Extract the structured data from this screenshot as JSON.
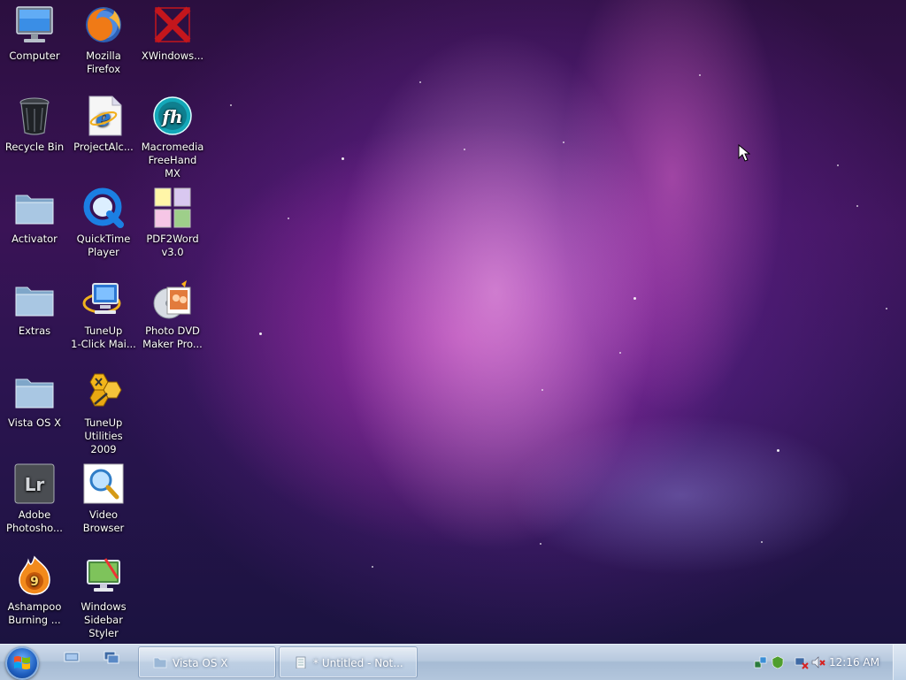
{
  "desktop": {
    "icons": [
      {
        "name": "computer",
        "label": "Computer"
      },
      {
        "name": "mozilla-firefox",
        "label": "Mozilla\nFirefox"
      },
      {
        "name": "xwindows",
        "label": "XWindows..."
      },
      {
        "name": "recycle-bin",
        "label": "Recycle Bin"
      },
      {
        "name": "projectalc",
        "label": "ProjectAlc..."
      },
      {
        "name": "macromedia-freehand",
        "label": "Macromedia\nFreeHand MX"
      },
      {
        "name": "activator",
        "label": "Activator"
      },
      {
        "name": "quicktime-player",
        "label": "QuickTime\nPlayer"
      },
      {
        "name": "pdf2word",
        "label": "PDF2Word\nv3.0"
      },
      {
        "name": "extras",
        "label": "Extras"
      },
      {
        "name": "tuneup-1click",
        "label": "TuneUp\n1-Click Mai..."
      },
      {
        "name": "photo-dvd-maker",
        "label": "Photo DVD\nMaker Pro..."
      },
      {
        "name": "vista-os-x",
        "label": "Vista OS X"
      },
      {
        "name": "tuneup-utilities",
        "label": "TuneUp\nUtilities 2009"
      },
      {
        "name": "adobe-photoshop",
        "label": "Adobe\nPhotosho..."
      },
      {
        "name": "video-browser",
        "label": "Video\nBrowser"
      },
      {
        "name": "ashampoo-burning",
        "label": "Ashampoo\nBurning ..."
      },
      {
        "name": "windows-sidebar-styler",
        "label": "Windows\nSidebar Styler"
      }
    ]
  },
  "taskbar": {
    "start_icon": "windows-logo-icon",
    "quick_launch": [
      "show-desktop-icon",
      "switch-windows-icon"
    ],
    "buttons": [
      {
        "label": "Vista OS X",
        "icon": "folder-icon"
      },
      {
        "label": "* Untitled - Not...",
        "icon": "notepad-icon"
      }
    ],
    "tray_icons": [
      "network-icon",
      "security-icon",
      "network-disconnected-icon",
      "volume-muted-icon"
    ],
    "clock": "12:16 AM"
  },
  "colors": {
    "taskbar": "#b7c9de",
    "wallpaper_accent": "#d94fd0"
  }
}
